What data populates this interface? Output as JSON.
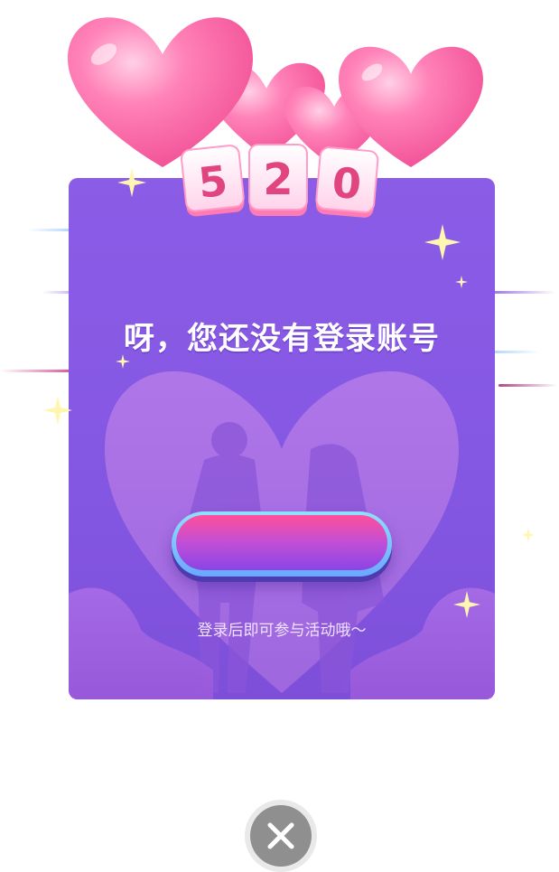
{
  "dialog": {
    "title": "呀，您还没有登录账号",
    "login_button_label": "",
    "hint": "登录后即可参与活动哦～",
    "badge_digits": [
      "5",
      "2",
      "0"
    ]
  },
  "icons": {
    "close": "close-icon",
    "balloons": "heart-balloons-icon",
    "couple": "couple-silhouette-icon",
    "sparkle": "sparkle-icon"
  },
  "colors": {
    "card": "#8b5ce6",
    "button_top": "#ff4f9a",
    "button_bottom": "#8a44e6",
    "heart_pink": "#ff6fae",
    "close_bg": "#8f8f8f"
  }
}
